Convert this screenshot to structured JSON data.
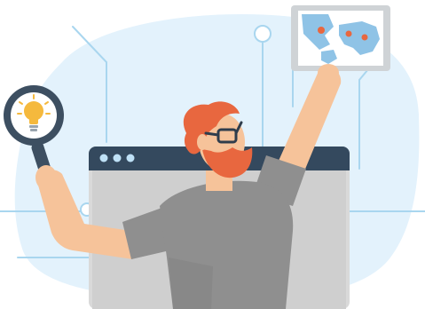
{
  "illustration": {
    "subject": "researcher-with-magnifier-and-map",
    "colors": {
      "background": "#ffffff",
      "blob": "#e3f2fc",
      "circuit_lines": "#a9d6ef",
      "browser_frame": "#d9d9d9",
      "browser_header": "#34495e",
      "browser_dots": "#bfe1f6",
      "browser_body": "#cfcfcf",
      "shirt": "#8f8f8f",
      "shirt_shadow": "#7a7a7a",
      "skin": "#f6c39a",
      "beard": "#e8673f",
      "hair": "#e8673f",
      "glasses": "#2f3d4c",
      "magnifier_ring": "#3d4f61",
      "magnifier_lens": "#ffffff",
      "bulb": "#f5b93d",
      "tablet_frame": "#cfd3d6",
      "tablet_screen": "#ffffff",
      "map_land": "#8fc3e6",
      "map_pins": "#e8673f"
    },
    "icons": [
      "magnifier-icon",
      "lightbulb-icon",
      "world-map-icon",
      "browser-window-icon"
    ]
  }
}
